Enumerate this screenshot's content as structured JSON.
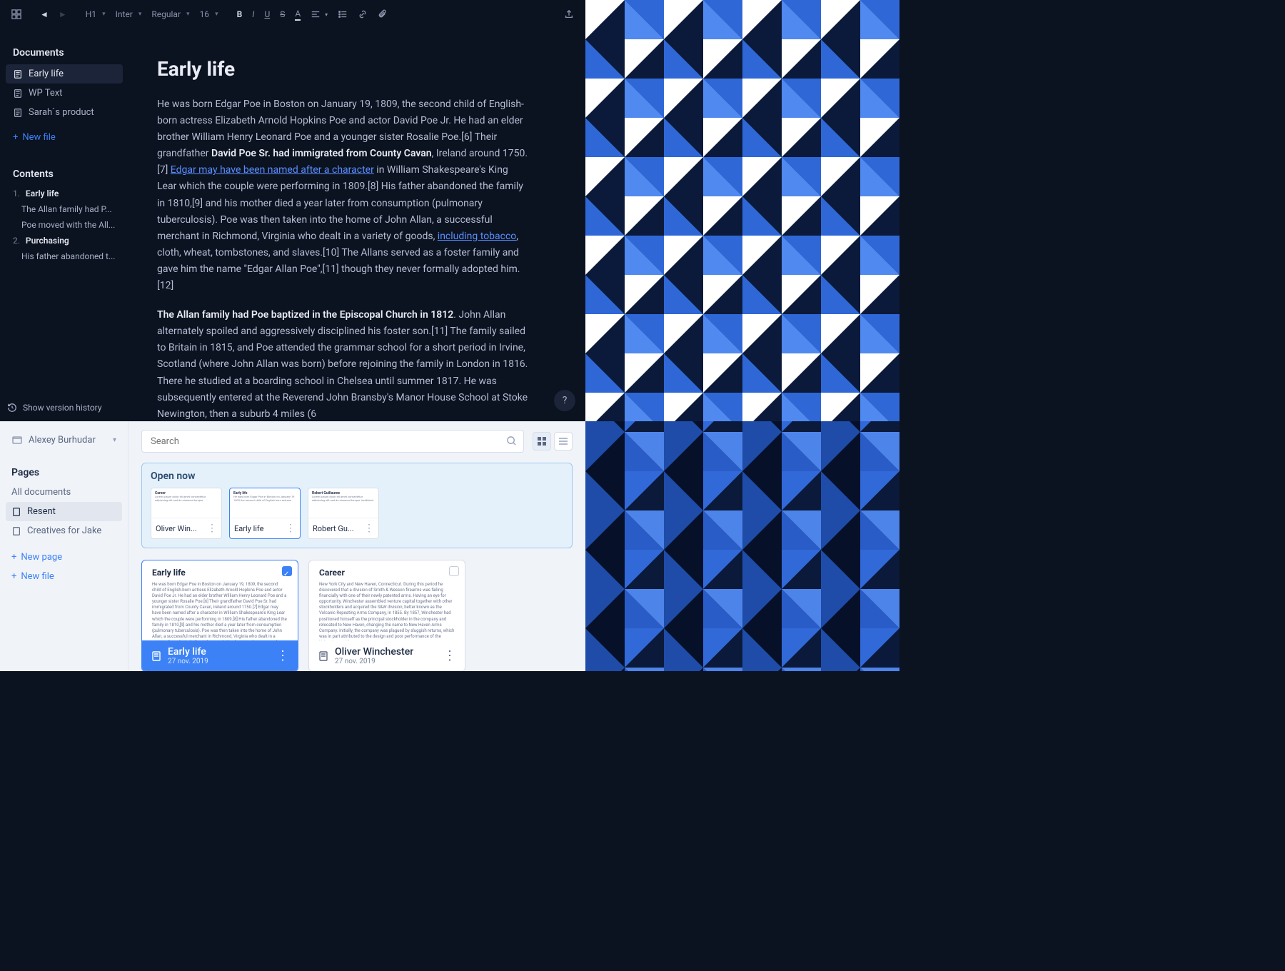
{
  "toolbar": {
    "heading": "H1",
    "font_family": "Inter",
    "font_weight": "Regular",
    "font_size": "16"
  },
  "sidebar": {
    "documents_title": "Documents",
    "items": [
      "Early life",
      "WP Text",
      "Sarah`s product"
    ],
    "new_file": "New file"
  },
  "contents": {
    "title": "Contents",
    "sections": [
      {
        "num": "1.",
        "title": "Early life",
        "subs": [
          "The Allan family had P...",
          "Poe moved with the All..."
        ]
      },
      {
        "num": "2.",
        "title": "Purchasing",
        "subs": [
          "His father abandoned t..."
        ]
      }
    ]
  },
  "version_history": "Show version history",
  "doc": {
    "title": "Early life",
    "p1a": "He was born Edgar Poe in Boston on January 19, 1809, the second child of English-born actress Elizabeth Arnold Hopkins Poe and actor David Poe Jr. He had an elder brother William Henry Leonard Poe and a younger sister Rosalie Poe.[6] Their grandfather ",
    "bold1": "David Poe Sr. had immigrated from County Cavan",
    "p1b": ", Ireland around 1750.[7] ",
    "link1": "Edgar may have been named after a character",
    "p1c": " in William Shakespeare's King Lear which the couple were performing in 1809.[8] His father abandoned the family in 1810,[9] and his mother died a year later from consumption (pulmonary tuberculosis). Poe was then taken into the home of John Allan, a successful merchant in Richmond, Virginia who dealt in a variety of goods, ",
    "link2": "including tobacco",
    "p1d": ", cloth, wheat, tombstones, and slaves.[10] The Allans served as a foster family and gave him the name \"Edgar Allan Poe\",[11] though they never formally adopted him.[12]",
    "p2bold": "The Allan family had Poe baptized in the Episcopal Church in 1812",
    "p2": ". John Allan alternately spoiled and aggressively disciplined his foster son.[11] The family sailed to Britain in 1815, and Poe attended the grammar school for a short period in Irvine, Scotland (where John Allan was born) before rejoining the family in London in 1816. There he studied at a boarding school in Chelsea until summer 1817. He was subsequently entered at the Reverend John Bransby's Manor House School at Stoke Newington, then a suburb 4 miles (6"
  },
  "help": "?",
  "browser": {
    "user": "Alexey Burhudar",
    "pages_title": "Pages",
    "pages": [
      "All documents",
      "Resent",
      "Creatives for Jake"
    ],
    "new_page": "New page",
    "new_file": "New file",
    "search_placeholder": "Search",
    "open_now": "Open now",
    "open_cards": [
      {
        "preview_title": "Career",
        "label": "Oliver Win..."
      },
      {
        "preview_title": "Early life",
        "label": "Early life"
      },
      {
        "preview_title": "Robert Guillaume",
        "label": "Robert Gu..."
      }
    ],
    "big_cards": [
      {
        "title": "Early life",
        "footer_title": "Early life",
        "date": "27 nov. 2019",
        "selected": true,
        "body": "He was born Edgar Poe in Boston on January 19, 1809, the second child of English-born actress Elizabeth Arnold Hopkins Poe and actor David Poe Jr. He had an elder brother William Henry Leonard Poe and a younger sister Rosalie Poe.[6] Their grandfather David Poe Sr. had immigrated from County Cavan, Ireland around 1750.[7] Edgar may have been named after a character in William Shakespeare's King Lear which the couple were performing in 1809.[8] His father abandoned the family in 1810,[9] and his mother died a year later from consumption (pulmonary tuberculosis). Poe was then taken into the home of John Allan, a successful merchant in Richmond, Virginia who dealt in a variety of goods, including tobacco, cloth, wheat, tombstones, and slaves.[10] The Allans served as a foster family and gave him the name \"Edgar Allan"
      },
      {
        "title": "Career",
        "footer_title": "Oliver Winchester",
        "date": "27 nov. 2019",
        "selected": false,
        "body": "New York City and New Haven, Connecticut. During this period he discovered that a division of Smith & Wesson firearms was failing financially with one of their newly patented arms. Having an eye for opportunity, Winchester assembled venture capital together with other stockholders and acquired the S&W division, better known as the Volcanic Repeating Arms Company, in 1855. By 1857, Winchester had positioned himself as the principal stockholder in the company and relocated to New Haven, changing the name to New Haven Arms Company.\n\nInitially, the company was plagued by sluggish returns, which was in part attributed to the design and poor performance of the Volcanic cartridge: a"
      }
    ]
  }
}
